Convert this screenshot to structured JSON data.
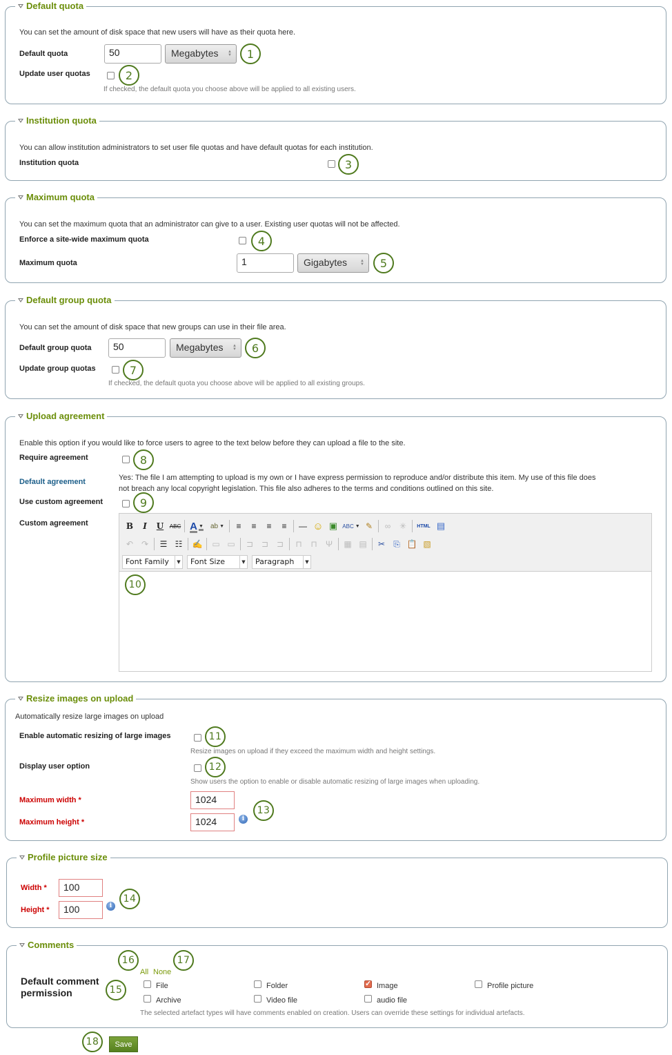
{
  "sections": {
    "default_quota": {
      "title": "Default quota",
      "description": "You can set the amount of disk space that new users will have as their quota here.",
      "quota_label": "Default quota",
      "quota_value": "50",
      "quota_unit": "Megabytes",
      "update_label": "Update user quotas",
      "update_checked": false,
      "update_help": "If checked, the default quota you choose above will be applied to all existing users."
    },
    "institution_quota": {
      "title": "Institution quota",
      "description": "You can allow institution administrators to set user file quotas and have default quotas for each institution.",
      "label": "Institution quota",
      "checked": false
    },
    "maximum_quota": {
      "title": "Maximum quota",
      "description": "You can set the maximum quota that an administrator can give to a user. Existing user quotas will not be affected.",
      "enforce_label": "Enforce a site-wide maximum quota",
      "enforce_checked": false,
      "max_label": "Maximum quota",
      "max_value": "1",
      "max_unit": "Gigabytes"
    },
    "default_group_quota": {
      "title": "Default group quota",
      "description": "You can set the amount of disk space that new groups can use in their file area.",
      "quota_label": "Default group quota",
      "quota_value": "50",
      "quota_unit": "Megabytes",
      "update_label": "Update group quotas",
      "update_checked": false,
      "update_help": "If checked, the default quota you choose above will be applied to all existing groups."
    },
    "upload_agreement": {
      "title": "Upload agreement",
      "description": "Enable this option if you would like to force users to agree to the text below before they can upload a file to the site.",
      "require_label": "Require agreement",
      "require_checked": false,
      "default_label": "Default agreement",
      "default_text_line1": "Yes: The file I am attempting to upload is my own or I have express permission to reproduce and/or distribute this item. My use of this file does",
      "default_text_line2": "not breach any local copyright legislation. This file also adheres to the terms and conditions outlined on this site.",
      "custom_toggle_label": "Use custom agreement",
      "custom_toggle_checked": false,
      "custom_label": "Custom agreement",
      "editor": {
        "toolbar_row1": [
          "bold",
          "italic",
          "underline",
          "strikethrough",
          "|",
          "font-color",
          "highlight-color",
          "|",
          "align-left",
          "align-center",
          "align-right",
          "align-justify",
          "|",
          "horizontal-rule",
          "emoticon",
          "image",
          "spellcheck",
          "cleanup",
          "|",
          "link",
          "unlink",
          "|",
          "html-source",
          "fullscreen"
        ],
        "toolbar_row2": [
          "undo",
          "redo",
          "|",
          "bullet-list",
          "numbered-list",
          "|",
          "edit",
          "|",
          "table-merge",
          "table-split",
          "|",
          "row-before",
          "row-after",
          "delete-row",
          "|",
          "col-before",
          "col-after",
          "delete-col",
          "|",
          "table",
          "table-props",
          "|",
          "cut",
          "copy",
          "paste",
          "paste-word"
        ],
        "font_family": "Font Family",
        "font_size": "Font Size",
        "format": "Paragraph",
        "content": ""
      }
    },
    "resize_images": {
      "title": "Resize images on upload",
      "description": "Automatically resize large images on upload",
      "enable_label": "Enable automatic resizing of large images",
      "enable_checked": false,
      "enable_help": "Resize images on upload if they exceed the maximum width and height settings.",
      "display_label": "Display user option",
      "display_checked": false,
      "display_help": "Show users the option to enable or disable automatic resizing of large images when uploading.",
      "width_label": "Maximum width *",
      "width_value": "1024",
      "height_label": "Maximum height *",
      "height_value": "1024"
    },
    "profile_picture": {
      "title": "Profile picture size",
      "width_label": "Width *",
      "width_value": "100",
      "height_label": "Height *",
      "height_value": "100"
    },
    "comments": {
      "title": "Comments",
      "all_label": "All",
      "none_label": "None",
      "label_line1": "Default comment",
      "label_line2": "permission",
      "options": [
        {
          "label": "File",
          "checked": false
        },
        {
          "label": "Folder",
          "checked": false
        },
        {
          "label": "Image",
          "checked": true
        },
        {
          "label": "Profile picture",
          "checked": false
        },
        {
          "label": "Archive",
          "checked": false
        },
        {
          "label": "Video file",
          "checked": false
        },
        {
          "label": "audio file",
          "checked": false
        }
      ],
      "help": "The selected artefact types will have comments enabled on creation. Users can override these settings for individual artefacts."
    }
  },
  "callouts": [
    "1",
    "2",
    "3",
    "4",
    "5",
    "6",
    "7",
    "8",
    "9",
    "10",
    "11",
    "12",
    "13",
    "14",
    "15",
    "16",
    "17",
    "18"
  ],
  "save_label": "Save",
  "colors": {
    "legend": "#6b8e0a",
    "callout": "#4f7a1e",
    "required": "#cc0000",
    "save_button": "#5e8a24"
  }
}
